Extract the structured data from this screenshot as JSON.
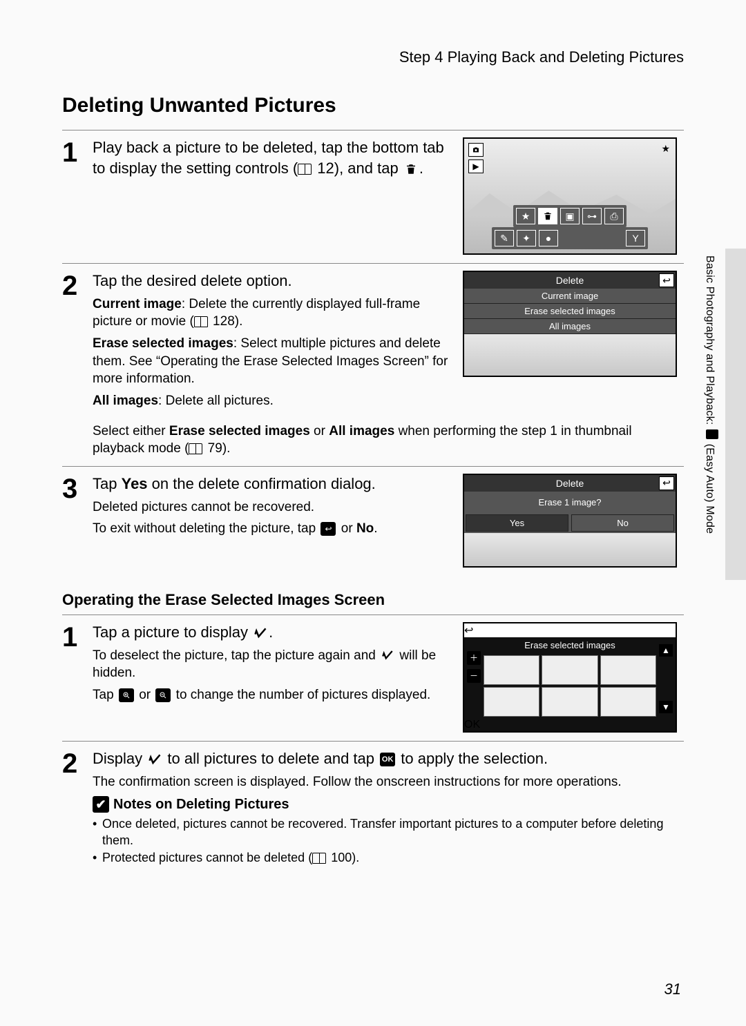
{
  "header": {
    "running_head": "Step 4 Playing Back and Deleting Pictures"
  },
  "title": "Deleting Unwanted Pictures",
  "side": {
    "label_before": "Basic Photography and Playback: ",
    "label_after": " (Easy Auto) Mode"
  },
  "steps_main": [
    {
      "num": "1",
      "lead_a": "Play back a picture to be deleted, tap the bottom tab to display the setting controls (",
      "lead_b": " 12), and tap "
    },
    {
      "num": "2",
      "lead": "Tap the desired delete option.",
      "opt1": {
        "name": "Current image",
        "text_a": ": Delete the currently displayed full-frame picture or movie ",
        "ref": " 128"
      },
      "opt2": {
        "name": "Erase selected images",
        "text": ": Select multiple pictures and delete them. See “Operating the Erase Selected Images Screen” for more information."
      },
      "opt3": {
        "name": "All images",
        "text": ": Delete all pictures."
      },
      "note_a": "Select either ",
      "note_b1": "Erase selected images",
      "note_or": " or ",
      "note_b2": "All images",
      "note_c": " when performing the step 1 in thumbnail playback mode ",
      "note_ref": " 79"
    },
    {
      "num": "3",
      "lead_a": "Tap",
      "lead_yes": "Yes",
      "lead_b": "on the delete confirmation dialog.",
      "detail1": "Deleted pictures cannot be recovered.",
      "detail2a": "To exit without deleting the picture, tap ",
      "detail2b": " or ",
      "detail2c": "No"
    }
  ],
  "subsection": {
    "title": "Operating the Erase Selected Images Screen"
  },
  "steps_sub": [
    {
      "num": "1",
      "lead": "Tap a picture to display ",
      "d1a": "To deselect the picture, tap the picture again and ",
      "d1b": " will be hidden.",
      "d2a": "Tap ",
      "d2or": " or ",
      "d2b": " to change the number of pictures displayed."
    },
    {
      "num": "2",
      "lead_a": "Display ",
      "lead_b": " to all pictures to delete and tap ",
      "lead_c": " to apply the selection.",
      "detail": "The confirmation screen is displayed. Follow the onscreen instructions for more operations."
    }
  ],
  "screens": {
    "delete_menu": {
      "title": "Delete",
      "items": [
        "Current image",
        "Erase selected images",
        "All images"
      ]
    },
    "confirm": {
      "title": "Delete",
      "prompt": "Erase 1 image?",
      "yes": "Yes",
      "no": "No"
    },
    "erase_grid": {
      "title": "Erase selected images",
      "ok": "OK"
    }
  },
  "notes": {
    "heading": "Notes on Deleting Pictures",
    "items": [
      "Once deleted, pictures cannot be recovered. Transfer important pictures to a computer before deleting them.",
      ""
    ],
    "items.1a": "Protected pictures cannot be deleted ",
    "items.1ref": " 100"
  },
  "page_number": "31"
}
